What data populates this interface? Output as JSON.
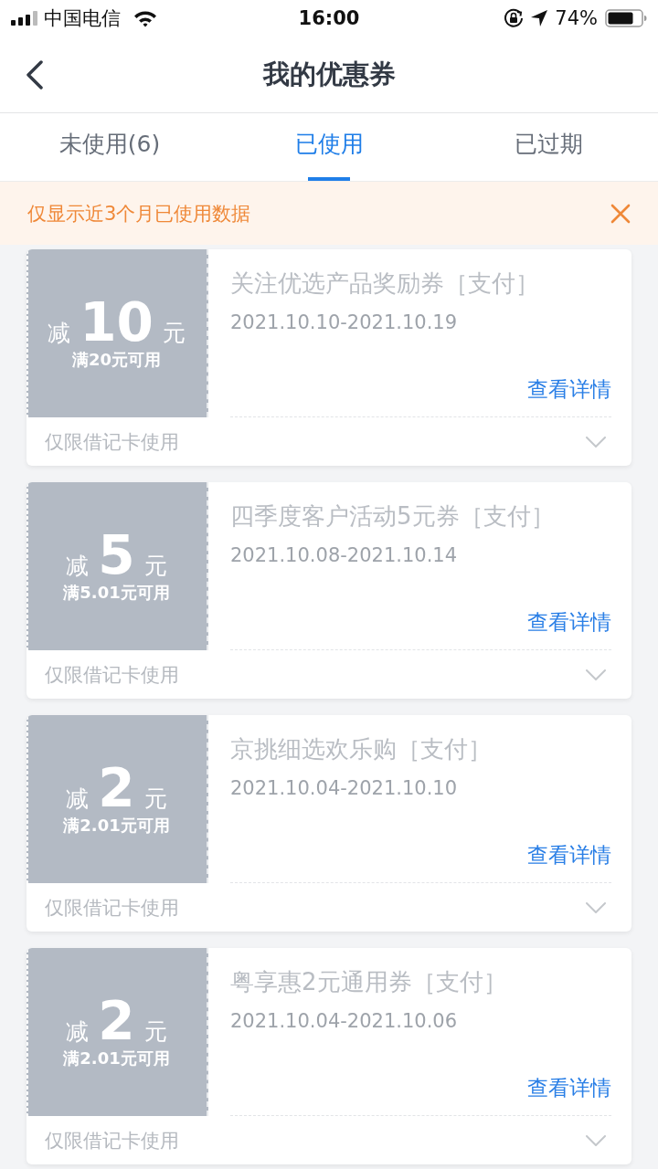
{
  "status_bar": {
    "carrier": "中国电信",
    "time": "16:00",
    "battery": "74%"
  },
  "nav": {
    "title": "我的优惠券"
  },
  "tabs": [
    {
      "label": "未使用(6)",
      "selected": false
    },
    {
      "label": "已使用",
      "selected": true
    },
    {
      "label": "已过期",
      "selected": false
    }
  ],
  "notice": {
    "text": "仅显示近3个月已使用数据"
  },
  "coupons": [
    {
      "prefix": "减",
      "amount": "10",
      "unit": "元",
      "condition": "满20元可用",
      "name": "关注优选产品奖励券［支付］",
      "period": "2021.10.10-2021.10.19",
      "detail_link": "查看详情",
      "restriction": "仅限借记卡使用",
      "used": true,
      "expanded": false
    },
    {
      "prefix": "减",
      "amount": "5",
      "unit": "元",
      "condition": "满5.01元可用",
      "name": "四季度客户活动5元券［支付］",
      "period": "2021.10.08-2021.10.14",
      "detail_link": "查看详情",
      "restriction": "仅限借记卡使用",
      "used": true,
      "expanded": false
    },
    {
      "prefix": "减",
      "amount": "2",
      "unit": "元",
      "condition": "满2.01元可用",
      "name": "京挑细选欢乐购［支付］",
      "period": "2021.10.04-2021.10.10",
      "detail_link": "查看详情",
      "restriction": "仅限借记卡使用",
      "used": true,
      "expanded": false
    },
    {
      "prefix": "减",
      "amount": "2",
      "unit": "元",
      "condition": "满2.01元可用",
      "name": "粤享惠2元通用券［支付］",
      "period": "2021.10.04-2021.10.06",
      "detail_link": "查看详情",
      "restriction": "仅限借记卡使用",
      "used": true,
      "expanded": false
    }
  ]
}
